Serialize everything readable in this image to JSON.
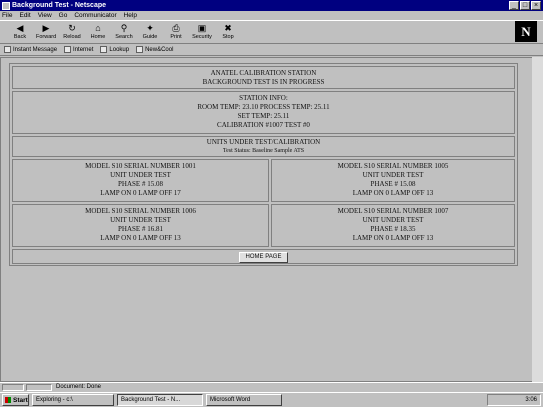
{
  "window": {
    "title": "Background Test - Netscape"
  },
  "menu": [
    "File",
    "Edit",
    "View",
    "Go",
    "Communicator",
    "Help"
  ],
  "toolbar": [
    {
      "label": "Back",
      "icon": "back-arrow-icon",
      "glyph": "◀"
    },
    {
      "label": "Forward",
      "icon": "forward-arrow-icon",
      "glyph": "▶"
    },
    {
      "label": "Reload",
      "icon": "reload-icon",
      "glyph": "↻"
    },
    {
      "label": "Home",
      "icon": "home-icon",
      "glyph": "⌂"
    },
    {
      "label": "Search",
      "icon": "search-icon",
      "glyph": "⚲"
    },
    {
      "label": "Guide",
      "icon": "guide-icon",
      "glyph": "✦"
    },
    {
      "label": "Print",
      "icon": "print-icon",
      "glyph": "⎙"
    },
    {
      "label": "Security",
      "icon": "lock-icon",
      "glyph": "▣"
    },
    {
      "label": "Stop",
      "icon": "stop-icon",
      "glyph": "✖"
    }
  ],
  "logo": "N",
  "links": [
    "Instant Message",
    "Internet",
    "Lookup",
    "New&Cool"
  ],
  "page": {
    "header": [
      "ANATEL CALIBRATION STATION",
      "BACKGROUND TEST IS IN PROGRESS"
    ],
    "station": [
      "STATION INFO:",
      "ROOM TEMP: 23.10 PROCESS TEMP: 25.11",
      "SET TEMP: 25.11",
      "CALIBRATION #1007 TEST #0"
    ],
    "units": [
      "UNITS UNDER TEST/CALIBRATION",
      "Test Status: Baseline Sample ATS"
    ],
    "units_list": [
      [
        "MODEL S10 SERIAL NUMBER 1001",
        "UNIT UNDER TEST",
        "PHASE # 15.08",
        "LAMP ON 0 LAMP OFF 17"
      ],
      [
        "MODEL S10 SERIAL NUMBER 1005",
        "UNIT UNDER TEST",
        "PHASE # 15.08",
        "LAMP ON 0 LAMP OFF 13"
      ],
      [
        "MODEL S10 SERIAL NUMBER 1006",
        "UNIT UNDER TEST",
        "PHASE # 16.81",
        "LAMP ON 0 LAMP OFF 13"
      ],
      [
        "MODEL S10 SERIAL NUMBER 1007",
        "UNIT UNDER TEST",
        "PHASE # 18.35",
        "LAMP ON 0 LAMP OFF 13"
      ]
    ],
    "home_button": "HOME PAGE"
  },
  "status": {
    "text": "Document: Done"
  },
  "taskbar": {
    "start": "Start",
    "tasks": [
      "Exploring - c:\\",
      "Background Test - N...",
      "Microsoft Word"
    ],
    "active_index": 1,
    "clock": "3:06"
  }
}
